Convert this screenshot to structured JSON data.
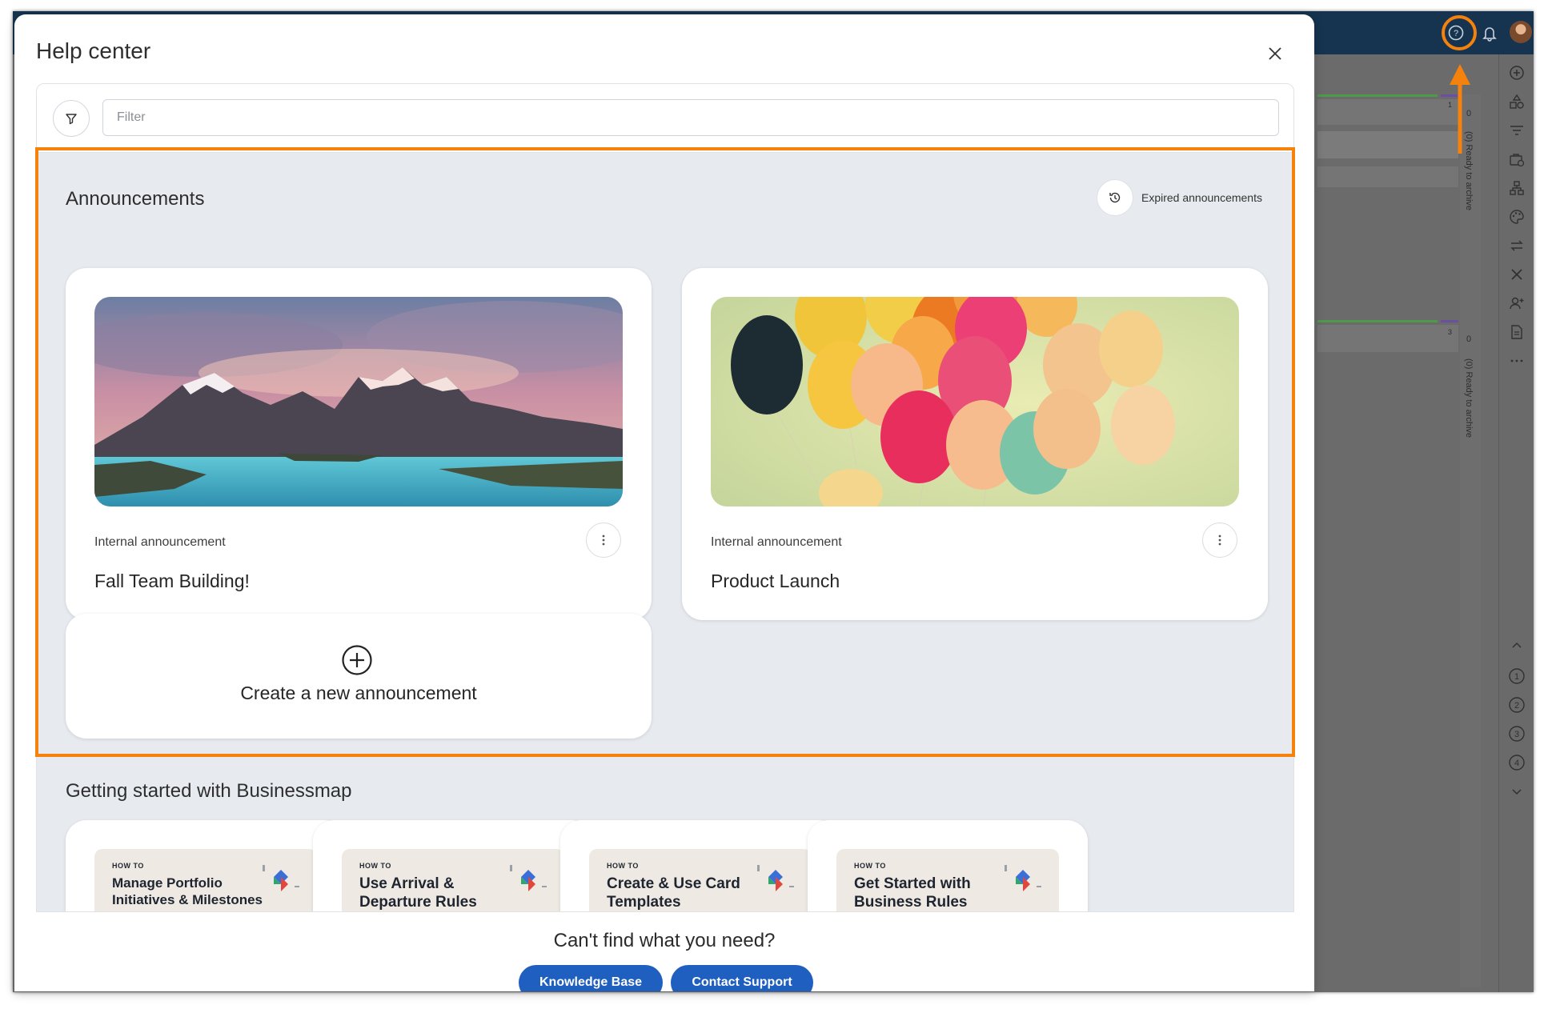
{
  "modal": {
    "title": "Help center",
    "close_icon": "close-icon"
  },
  "filter": {
    "placeholder": "Filter",
    "value": "",
    "icon": "filter-icon"
  },
  "announcements": {
    "title": "Announcements",
    "expired_label": "Expired announcements",
    "expired_icon": "history-icon",
    "cards": [
      {
        "type": "Internal announcement",
        "name": "Fall Team Building!",
        "image": "mountain-lake-landscape"
      },
      {
        "type": "Internal announcement",
        "name": "Product Launch",
        "image": "colorful-balloons"
      }
    ],
    "create_label": "Create a new announcement",
    "create_icon": "plus-circle-icon"
  },
  "getting_started": {
    "title": "Getting started with Businessmap",
    "cards": [
      {
        "how": "HOW TO",
        "title": "Manage Portfolio Initiatives & Milestones Using Planning Views"
      },
      {
        "how": "HOW TO",
        "title": "Use Arrival & Departure Rules"
      },
      {
        "how": "HOW TO",
        "title": "Create & Use Card Templates"
      },
      {
        "how": "HOW TO",
        "title": "Get Started with Business Rules"
      }
    ]
  },
  "footer": {
    "question": "Can't find what you need?",
    "knowledge_base": "Knowledge Base",
    "contact_support": "Contact Support"
  },
  "background": {
    "board": {
      "column_label_1": "(0) Ready to archive",
      "column_label_2": "(0) Ready to archive",
      "count_1": "0",
      "count_2": "0",
      "wip_1": "1",
      "wip_2": "3"
    },
    "right_rail_steps": [
      "1",
      "2",
      "3",
      "4"
    ],
    "colors": {
      "highlight": "#f5820d",
      "topbar": "#16344f",
      "primary_button": "#1f5fbf"
    }
  }
}
